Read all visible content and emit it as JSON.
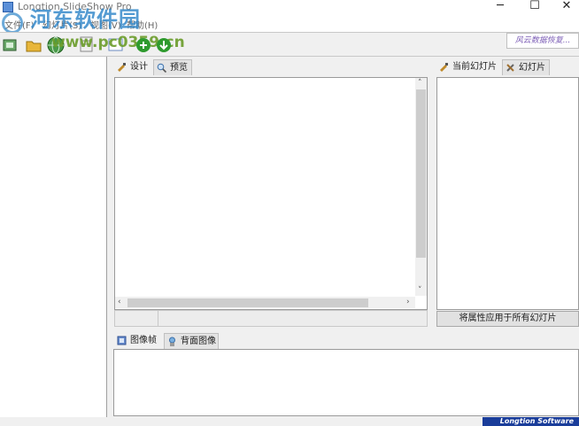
{
  "window": {
    "title": "Longtion SlideShow Pro",
    "minimize_glyph": "─",
    "maximize_glyph": "☐",
    "close_glyph": "✕"
  },
  "watermark": {
    "cn_text": "河东软件园",
    "url_text": "www.pc0359.cn"
  },
  "menu": {
    "items": [
      "文件(F)",
      "幻灯片(S)",
      "视图(V)",
      "帮助(H)"
    ]
  },
  "toolbar": {
    "buttons": [
      {
        "icon": "new-slideshow-icon",
        "color": "#3a7a3a"
      },
      {
        "icon": "open-folder-icon",
        "color": "#d9a62a"
      },
      {
        "icon": "globe-icon",
        "color": "#3a8a3a"
      },
      {
        "icon": "properties-icon",
        "color": "#8a8a8a"
      },
      {
        "icon": "slide-icon",
        "color": "#7a9ac8"
      },
      {
        "icon": "add-green-icon",
        "color": "#2e9a2e"
      },
      {
        "icon": "download-green-icon",
        "color": "#2e9a2e"
      }
    ],
    "promo_text": "风云数据恢复..."
  },
  "design_tabs": {
    "design_label": "设计",
    "preview_label": "预览"
  },
  "slide_tabs": {
    "current_label": "当前幻灯片",
    "slides_label": "幻灯片"
  },
  "apply_all_label": "将属性应用于所有幻灯片",
  "bottom_tabs": {
    "frame_label": "图像帧",
    "background_label": "背面图像"
  },
  "scroll": {
    "up": "˄",
    "down": "˅",
    "left": "‹",
    "right": "›"
  },
  "status": {
    "brand": "Longtion Software"
  },
  "colors": {
    "accent": "#1a3d9a",
    "watermark": "#2f86c9",
    "url_watermark": "#6b9c2a"
  }
}
